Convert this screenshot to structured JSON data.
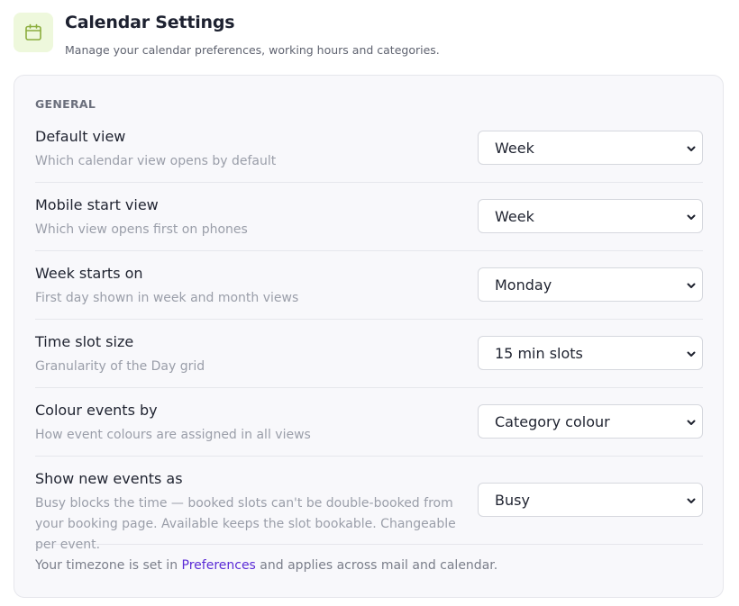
{
  "header": {
    "icon": "calendar-icon",
    "title": "Calendar Settings",
    "subtitle": "Manage your calendar preferences, working hours and categories."
  },
  "general": {
    "section_label": "GENERAL",
    "rows": [
      {
        "title": "Default view",
        "description": "Which calendar view opens by default",
        "value": "Week"
      },
      {
        "title": "Mobile start view",
        "description": "Which view opens first on phones",
        "value": "Week"
      },
      {
        "title": "Week starts on",
        "description": "First day shown in week and month views",
        "value": "Monday"
      },
      {
        "title": "Time slot size",
        "description": "Granularity of the Day grid",
        "value": "15 min slots"
      },
      {
        "title": "Colour events by",
        "description": "How event colours are assigned in all views",
        "value": "Category colour"
      },
      {
        "title": "Show new events as",
        "description": "Busy blocks the time — booked slots can't be double-booked from your booking page. Available keeps the slot bookable. Changeable per event.",
        "value": "Busy"
      }
    ]
  },
  "footer": {
    "note_before": "Your timezone is set in ",
    "link": "Preferences",
    "note_after": " and applies across mail and calendar."
  },
  "colors": {
    "accent_link": "#5b2bd6",
    "icon_bg": "#eef8dc",
    "icon_stroke": "#8cae3e"
  }
}
